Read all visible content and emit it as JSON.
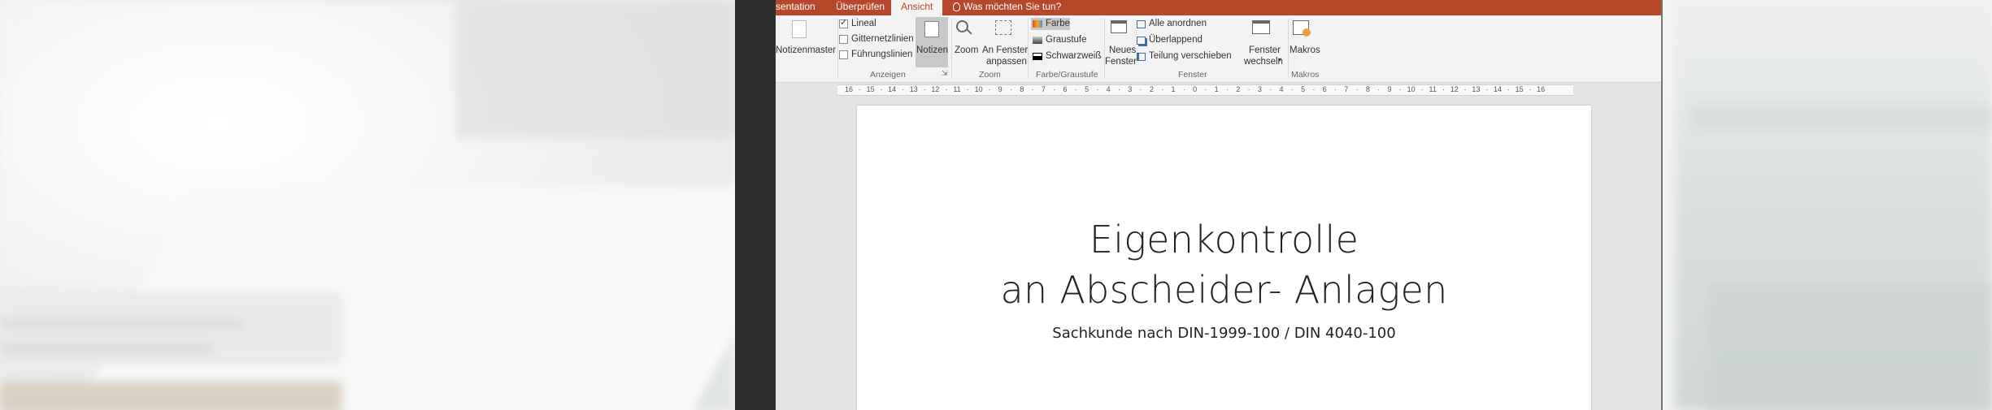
{
  "tabs": {
    "presentation": "sentation",
    "review": "Überprüfen",
    "view": "Ansicht",
    "tell_me": "Was möchten Sie tun?"
  },
  "ribbon": {
    "master": {
      "notes_master": "Notizenmaster"
    },
    "show": {
      "group_label": "Anzeigen",
      "ruler": "Lineal",
      "ruler_checked": true,
      "gridlines": "Gitternetzlinien",
      "gridlines_checked": false,
      "guides": "Führungslinien",
      "guides_checked": false,
      "notes": "Notizen"
    },
    "zoom": {
      "group_label": "Zoom",
      "zoom": "Zoom",
      "fit_line1": "An Fenster",
      "fit_line2": "anpassen"
    },
    "color": {
      "group_label": "Farbe/Graustufe",
      "color": "Farbe",
      "grayscale": "Graustufe",
      "bw": "Schwarzweiß"
    },
    "window": {
      "group_label": "Fenster",
      "new_line1": "Neues",
      "new_line2": "Fenster",
      "arrange_all": "Alle anordnen",
      "cascade": "Überlappend",
      "move_split": "Teilung verschieben",
      "switch_line1": "Fenster",
      "switch_line2": "wechseln"
    },
    "macros": {
      "group_label": "Makros",
      "macros": "Makros"
    }
  },
  "ruler_ticks": [
    "16",
    "15",
    "14",
    "13",
    "12",
    "11",
    "10",
    "9",
    "8",
    "7",
    "6",
    "5",
    "4",
    "3",
    "2",
    "1",
    "0",
    "1",
    "2",
    "3",
    "4",
    "5",
    "6",
    "7",
    "8",
    "9",
    "10",
    "11",
    "12",
    "13",
    "14",
    "15",
    "16"
  ],
  "slide": {
    "title_line1": "Eigenkontrolle",
    "title_line2": "an Abscheider- Anlagen",
    "subtitle": "Sachkunde nach DIN-1999-100 / DIN 4040-100"
  },
  "colors": {
    "accent": "#b7472a",
    "ribbon_bg": "#f3f3f3",
    "workspace_bg": "#e4e4e4"
  }
}
